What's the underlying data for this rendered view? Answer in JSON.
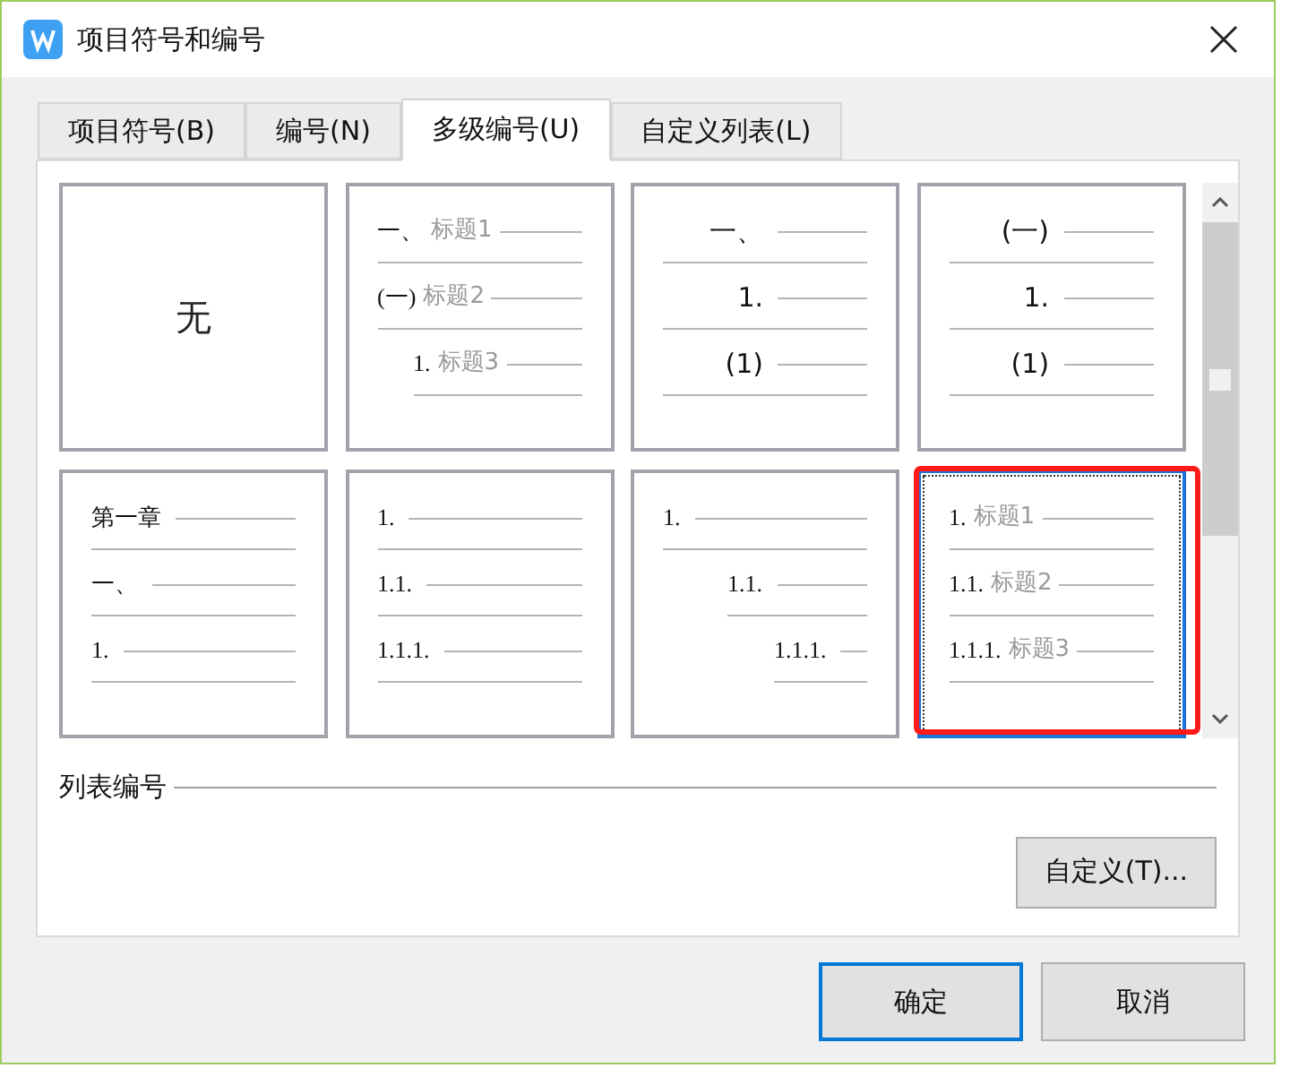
{
  "window": {
    "title": "项目符号和编号"
  },
  "tabs": [
    {
      "label": "项目符号(B)",
      "selected": false
    },
    {
      "label": "编号(N)",
      "selected": false
    },
    {
      "label": "多级编号(U)",
      "selected": true
    },
    {
      "label": "自定义列表(L)",
      "selected": false
    }
  ],
  "styles": [
    {
      "kind": "none",
      "label": "无",
      "selected": false
    },
    {
      "kind": "stepped",
      "selected": false,
      "lines": [
        {
          "number": "一、",
          "heading": "标题1"
        },
        {
          "number": "(一)",
          "heading": "标题2"
        },
        {
          "number": "1.",
          "heading": "标题3"
        }
      ]
    },
    {
      "kind": "right",
      "selected": false,
      "lines": [
        {
          "number": "一、"
        },
        {
          "number": "1."
        },
        {
          "number": "(1)"
        }
      ]
    },
    {
      "kind": "right",
      "selected": false,
      "lines": [
        {
          "number": "(一)"
        },
        {
          "number": "1."
        },
        {
          "number": "(1)"
        }
      ]
    },
    {
      "kind": "left",
      "selected": false,
      "lines": [
        {
          "number": "第一章"
        },
        {
          "number": "一、"
        },
        {
          "number": "1."
        }
      ]
    },
    {
      "kind": "left",
      "selected": false,
      "lines": [
        {
          "number": "1."
        },
        {
          "number": "1.1."
        },
        {
          "number": "1.1.1."
        }
      ]
    },
    {
      "kind": "cascade",
      "selected": false,
      "lines": [
        {
          "number": "1."
        },
        {
          "number": "1.1."
        },
        {
          "number": "1.1.1."
        }
      ]
    },
    {
      "kind": "left",
      "selected": true,
      "lines": [
        {
          "number": "1.",
          "heading": "标题1"
        },
        {
          "number": "1.1.",
          "heading": "标题2"
        },
        {
          "number": "1.1.1.",
          "heading": "标题3"
        }
      ]
    }
  ],
  "section": {
    "title": "列表编号"
  },
  "customize_button": "自定义(T)...",
  "buttons": [
    {
      "label": "确定",
      "selected": true
    },
    {
      "label": "取消",
      "selected": false
    }
  ]
}
